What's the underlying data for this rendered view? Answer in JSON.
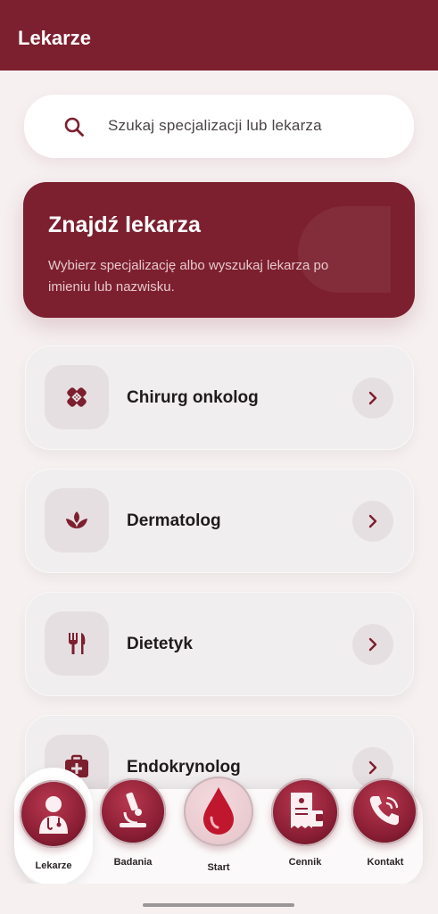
{
  "header": {
    "title": "Lekarze"
  },
  "search": {
    "placeholder": "Szukaj specjalizacji lub lekarza"
  },
  "hero": {
    "title": "Znajdź lekarza",
    "subtitle": "Wybierz specjalizację albo wyszukaj lekarza po imieniu lub nazwisku."
  },
  "specializations": [
    {
      "label": "Chirurg onkolog",
      "icon": "bandage-icon"
    },
    {
      "label": "Dermatolog",
      "icon": "lotus-icon"
    },
    {
      "label": "Dietetyk",
      "icon": "fork-knife-icon"
    },
    {
      "label": "Endokrynolog",
      "icon": "medical-bag-icon"
    }
  ],
  "nav": [
    {
      "label": "Lekarze",
      "icon": "doctor-icon",
      "active": true
    },
    {
      "label": "Badania",
      "icon": "microscope-icon",
      "active": false
    },
    {
      "label": "Start",
      "icon": "blood-drop-icon",
      "active": false
    },
    {
      "label": "Cennik",
      "icon": "receipt-icon",
      "active": false
    },
    {
      "label": "Kontakt",
      "icon": "phone-icon",
      "active": false
    }
  ],
  "colors": {
    "accent": "#7c1f2e",
    "background": "#f6f0f1",
    "card": "#f1eeef"
  }
}
